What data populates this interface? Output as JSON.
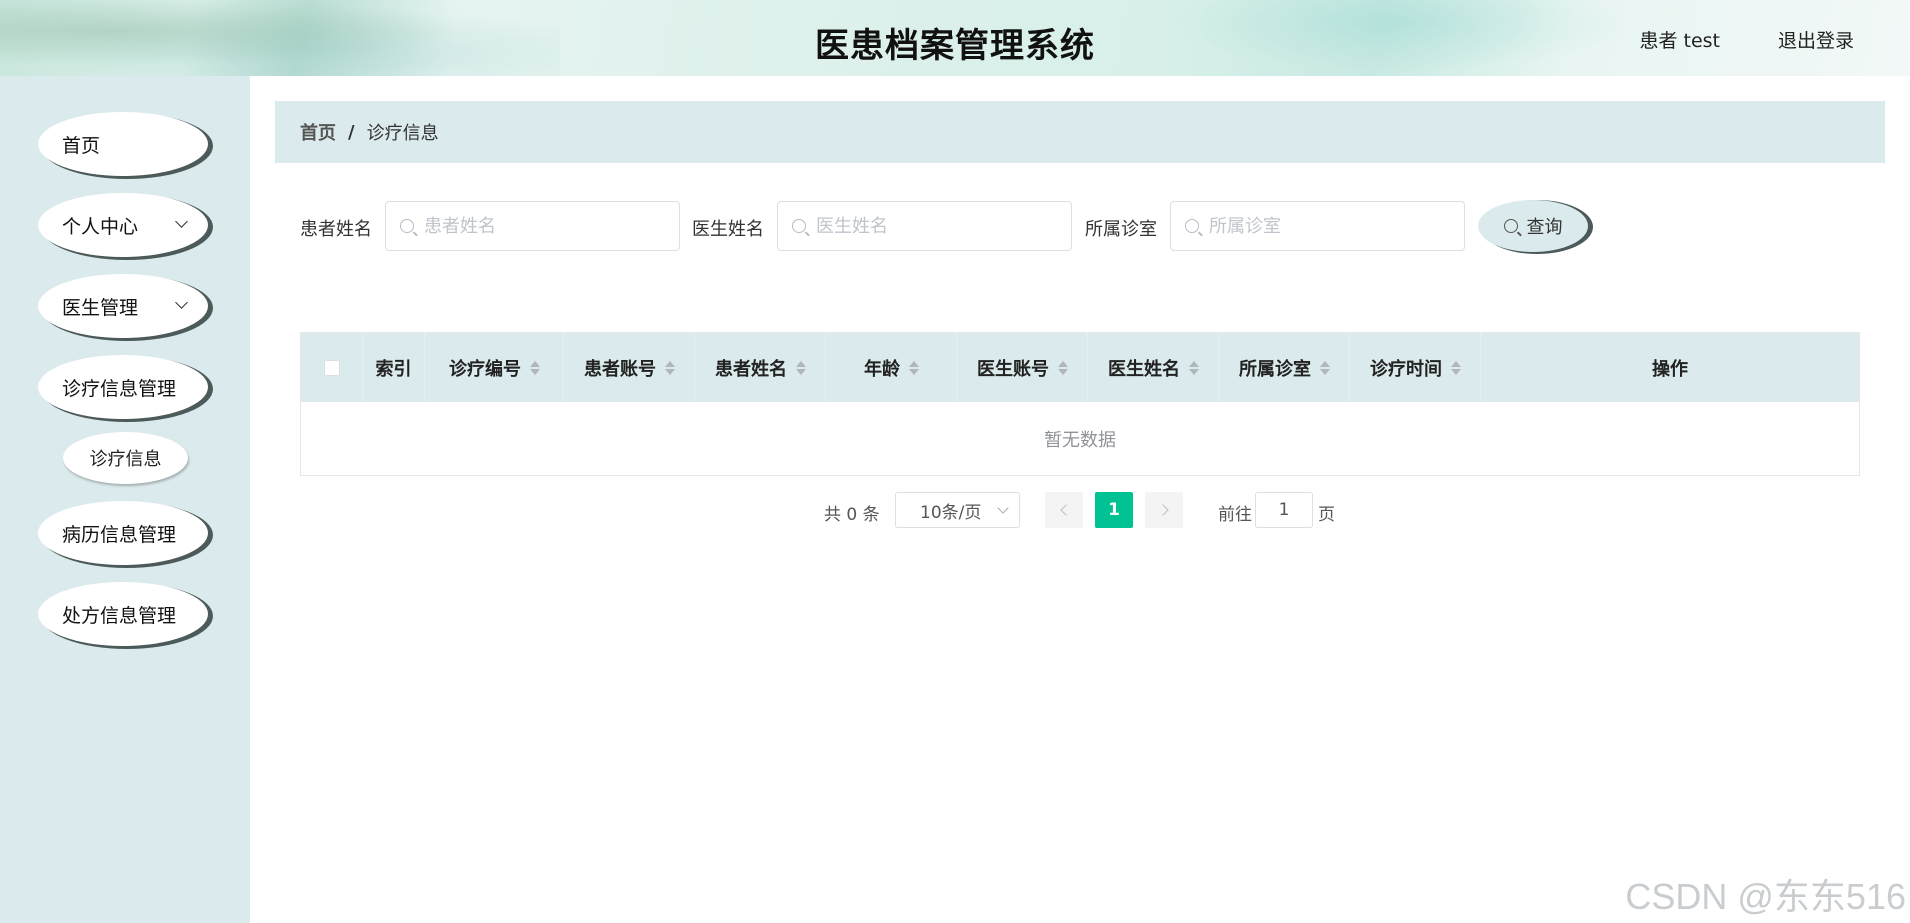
{
  "header": {
    "title": "医患档案管理系统",
    "user": "患者 test",
    "logout_label": "退出登录"
  },
  "sidebar": {
    "items": [
      {
        "label": "首页",
        "expandable": false
      },
      {
        "label": "个人中心",
        "expandable": true
      },
      {
        "label": "医生管理",
        "expandable": true
      },
      {
        "label": "诊疗信息管理",
        "expandable": false
      },
      {
        "label": "病历信息管理",
        "expandable": false
      },
      {
        "label": "处方信息管理",
        "expandable": false
      }
    ],
    "active_sub": "诊疗信息"
  },
  "breadcrumb": {
    "home": "首页",
    "separator": "/",
    "current": "诊疗信息"
  },
  "search": {
    "fields": [
      {
        "label": "患者姓名",
        "placeholder": "患者姓名",
        "value": ""
      },
      {
        "label": "医生姓名",
        "placeholder": "医生姓名",
        "value": ""
      },
      {
        "label": "所属诊室",
        "placeholder": "所属诊室",
        "value": ""
      }
    ],
    "button_label": "查询"
  },
  "table": {
    "columns": [
      "索引",
      "诊疗编号",
      "患者账号",
      "患者姓名",
      "年龄",
      "医生账号",
      "医生姓名",
      "所属诊室",
      "诊疗时间",
      "操作"
    ],
    "rows": [],
    "empty_text": "暂无数据"
  },
  "pagination": {
    "total_text": "共 0 条",
    "page_size": "10条/页",
    "current_page": "1",
    "goto_label": "前往",
    "goto_value": "1",
    "page_unit": "页"
  },
  "watermark": "CSDN @东东516",
  "colors": {
    "accent": "#00c292",
    "panel": "#dbeaec",
    "pill_shadow": "#4d5a5a"
  }
}
